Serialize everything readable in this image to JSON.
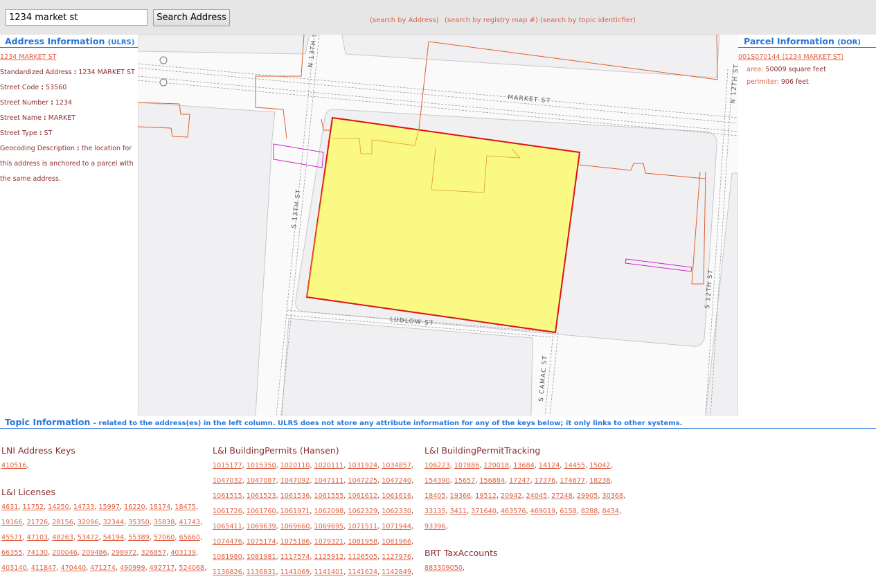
{
  "search": {
    "value": "1234 market st",
    "button_label": "Search Address"
  },
  "top_links": [
    "(search by Address)",
    "(search by registry map #)",
    "(search by topic identicfier)"
  ],
  "address": {
    "heading": "Address Information",
    "heading_sub": "(ULRS)",
    "link": "1234 MARKET ST",
    "fields": [
      {
        "label": "Standardized Address",
        "value": "1234 MARKET ST"
      },
      {
        "label": "Street Code",
        "value": "53560"
      },
      {
        "label": "Street Number",
        "value": "1234"
      },
      {
        "label": "Street Name",
        "value": "MARKET"
      },
      {
        "label": "Street Type",
        "value": "ST"
      }
    ],
    "geocoding_label": "Geocoding Description",
    "geocoding_value_1": "the location for",
    "geocoding_value_2": "this address is anchored to a parcel with",
    "geocoding_value_3": "the same address."
  },
  "parcel": {
    "heading": "Parcel Information",
    "heading_sub": "(DOR)",
    "link": "001S070144 (1234 MARKET ST)",
    "area_label": "area:",
    "area_value": "50009 square feet",
    "perimeter_label": "perimiter:",
    "perimeter_value": "906 feet"
  },
  "map": {
    "streets": [
      "MARKET ST",
      "LUDLOW ST",
      "N 13TH ST",
      "S 13TH ST",
      "N 12TH ST",
      "S 12TH ST",
      "S CAMAC ST"
    ],
    "highlight_fill": "#f9f97c",
    "highlight_stroke": "#e01010",
    "lot_color": "#e0602a",
    "alt_color": "#cc22cc"
  },
  "topic": {
    "heading": "Topic Information",
    "heading_sub": "- related to the address(es) in the left column. ULRS does not store any attribute information for any of the keys below; it only links to other systems.",
    "groups": [
      {
        "title": "LNI Address Keys",
        "keys": [
          "410516"
        ]
      },
      {
        "title": "L&I Licenses",
        "keys": [
          "4631",
          "11752",
          "14250",
          "14733",
          "15997",
          "16220",
          "18174",
          "18475",
          "19166",
          "21726",
          "28156",
          "32096",
          "32344",
          "35350",
          "35838",
          "41743",
          "45571",
          "47103",
          "48263",
          "53472",
          "54194",
          "55389",
          "57060",
          "65660",
          "66355",
          "74130",
          "200046",
          "209486",
          "298972",
          "326857",
          "403139",
          "403140",
          "411847",
          "470440",
          "471274",
          "490999",
          "492717",
          "524068"
        ]
      },
      {
        "title": "L&I BuildingPermits (Hansen)",
        "keys": [
          "1015177",
          "1015350",
          "1020110",
          "1020111",
          "1031924",
          "1034857",
          "1047032",
          "1047087",
          "1047092",
          "1047111",
          "1047225",
          "1047240",
          "1061515",
          "1061523",
          "1061536",
          "1061555",
          "1061612",
          "1061616",
          "1061726",
          "1061760",
          "1061971",
          "1062098",
          "1062329",
          "1062330",
          "1065411",
          "1069639",
          "1069660",
          "1069695",
          "1071511",
          "1071944",
          "1074476",
          "1075174",
          "1075186",
          "1079321",
          "1081958",
          "1081966",
          "1081980",
          "1081981",
          "1117574",
          "1125912",
          "1126505",
          "1127976",
          "1136826",
          "1136831",
          "1141069",
          "1141401",
          "1141624",
          "1142849"
        ]
      },
      {
        "title": "L&I BuildingPermitTracking",
        "keys": [
          "106223",
          "107886",
          "120018",
          "13684",
          "14124",
          "14455",
          "15042",
          "154390",
          "15657",
          "156884",
          "17247",
          "17376",
          "174677",
          "18238",
          "18405",
          "19366",
          "19512",
          "20942",
          "24045",
          "27248",
          "29905",
          "30368",
          "33135",
          "3411",
          "371640",
          "463576",
          "469019",
          "6158",
          "8288",
          "8434",
          "93396"
        ]
      },
      {
        "title": "BRT TaxAccounts",
        "keys": [
          "883309050"
        ]
      }
    ]
  }
}
